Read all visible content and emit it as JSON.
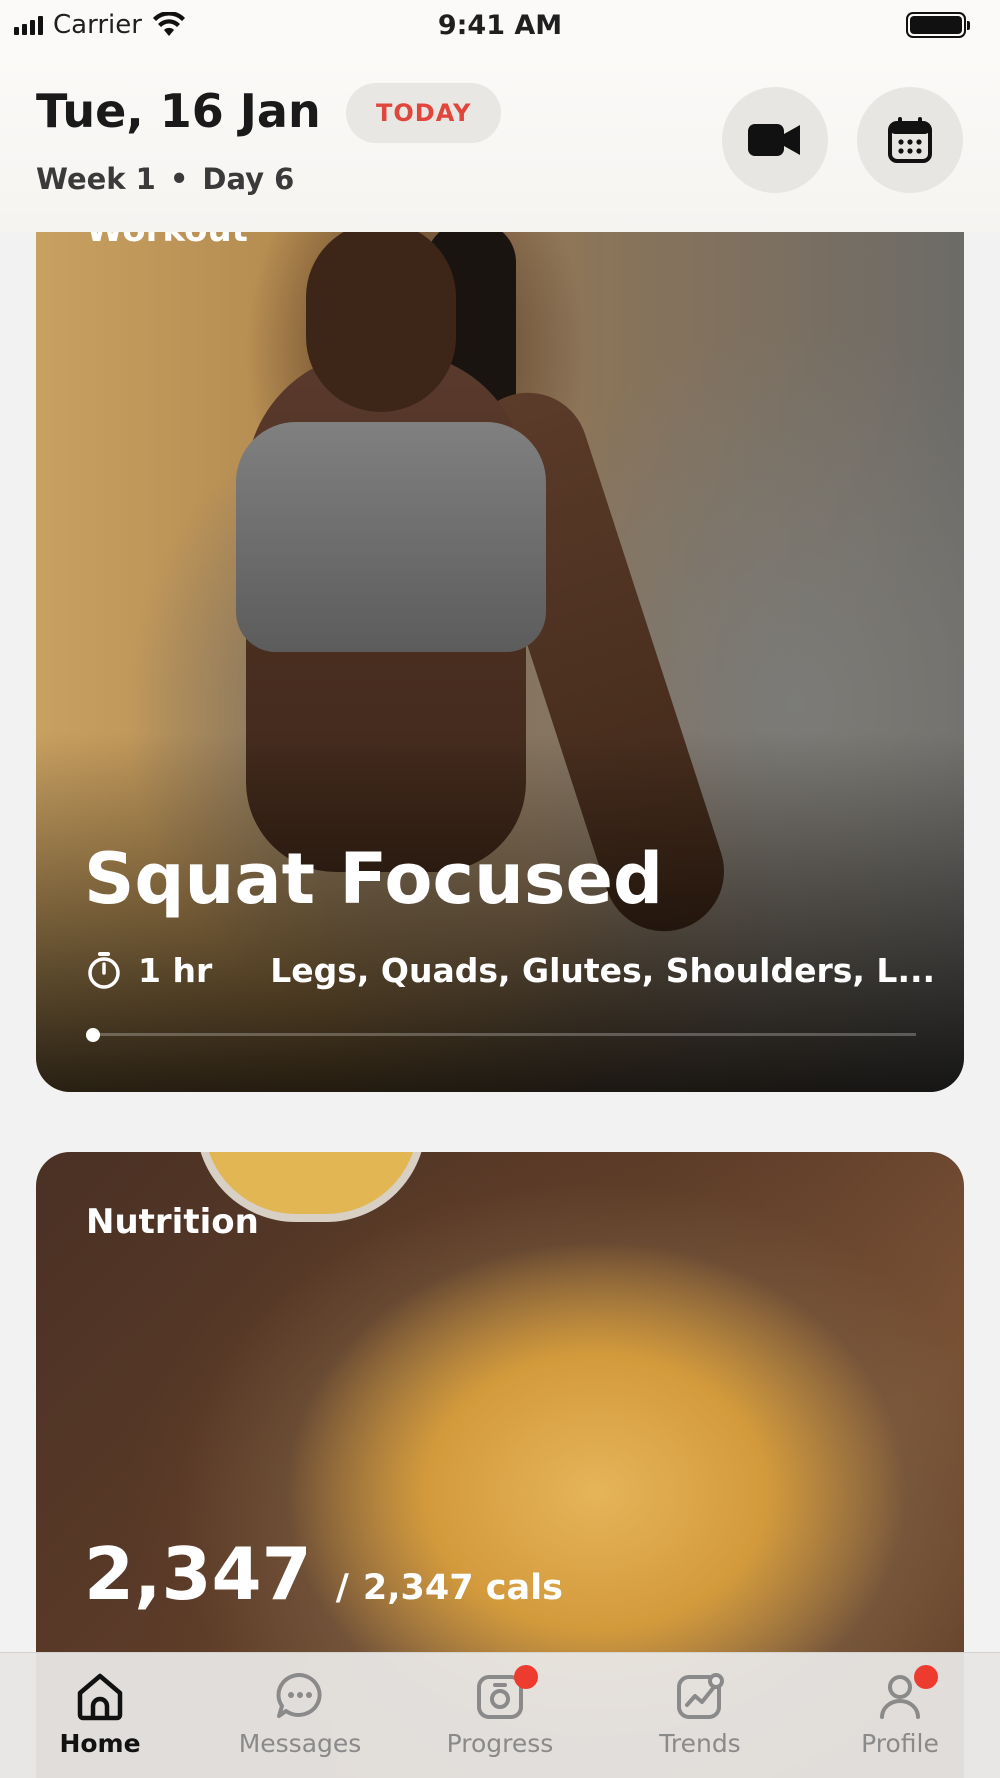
{
  "status_bar": {
    "carrier": "Carrier",
    "time": "9:41 AM"
  },
  "header": {
    "date": "Tue, 16 Jan",
    "today_badge": "TODAY",
    "week": "Week 1",
    "separator": "•",
    "day": "Day 6"
  },
  "workout": {
    "label": "Workout",
    "title": "Squat Focused",
    "duration": "1 hr",
    "muscles": "Legs, Quads, Glutes, Shoulders, L...",
    "progress": 0
  },
  "nutrition": {
    "label": "Nutrition",
    "calories": "2,347",
    "separator": "/",
    "target": "2,347 cals"
  },
  "tabs": [
    {
      "label": "Home",
      "icon": "home-icon",
      "active": true,
      "badge": false
    },
    {
      "label": "Messages",
      "icon": "chat-icon",
      "active": false,
      "badge": false
    },
    {
      "label": "Progress",
      "icon": "camera-progress-icon",
      "active": false,
      "badge": true
    },
    {
      "label": "Trends",
      "icon": "trend-chart-icon",
      "active": false,
      "badge": false
    },
    {
      "label": "Profile",
      "icon": "profile-icon",
      "active": false,
      "badge": true
    }
  ],
  "colors": {
    "accent": "#e0463b",
    "badge": "#ee3b30",
    "active_tab": "#111111",
    "inactive_tab": "#8a8a8a"
  }
}
